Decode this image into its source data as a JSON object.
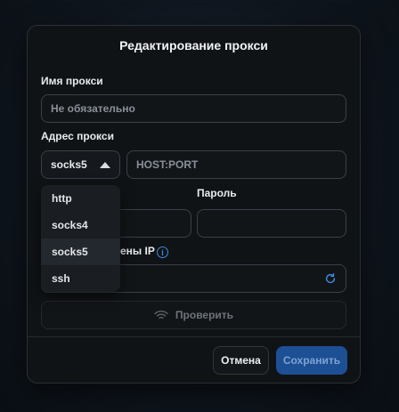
{
  "dialog": {
    "title": "Редактирование прокси",
    "name_label": "Имя прокси",
    "name_placeholder": "Не обязательно",
    "address_label": "Адрес прокси",
    "protocol_selected": "socks5",
    "protocol_options": [
      "http",
      "socks4",
      "socks5",
      "ssh"
    ],
    "host_placeholder": "HOST:PORT",
    "password_label": "Пароль",
    "ip_change_label_partial": "ены IP",
    "check_label": "Проверить",
    "cancel_label": "Отмена",
    "save_label": "Сохранить"
  },
  "colors": {
    "accent": "#1d4f94",
    "info": "#3d8ae0"
  }
}
